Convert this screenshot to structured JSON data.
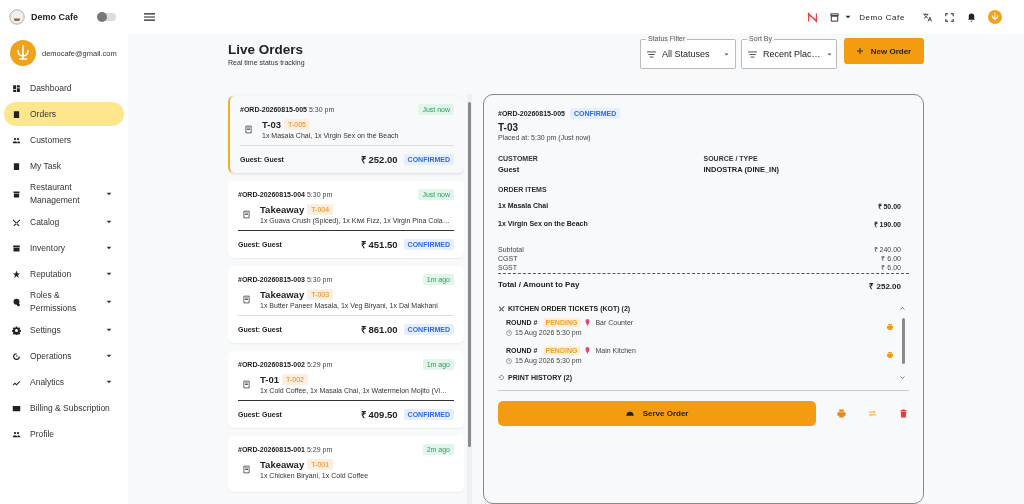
{
  "brand": {
    "name": "Demo Cafe",
    "theme_toggle_on": false
  },
  "user": {
    "email": "democafe@gmail.com"
  },
  "sidebar": {
    "items": [
      {
        "label": "Dashboard",
        "selected": false,
        "expandable": false
      },
      {
        "label": "Orders",
        "selected": true,
        "expandable": false
      },
      {
        "label": "Customers",
        "selected": false,
        "expandable": false
      },
      {
        "label": "My Task",
        "selected": false,
        "expandable": false
      },
      {
        "label": "Restaurant Management",
        "selected": false,
        "expandable": true
      },
      {
        "label": "Catalog",
        "selected": false,
        "expandable": true
      },
      {
        "label": "Inventory",
        "selected": false,
        "expandable": true
      },
      {
        "label": "Reputation",
        "selected": false,
        "expandable": true
      },
      {
        "label": "Roles & Permissions",
        "selected": false,
        "expandable": true
      },
      {
        "label": "Settings",
        "selected": false,
        "expandable": true
      },
      {
        "label": "Operations",
        "selected": false,
        "expandable": true
      },
      {
        "label": "Analytics",
        "selected": false,
        "expandable": true
      },
      {
        "label": "Billing & Subscription",
        "selected": false,
        "expandable": false
      },
      {
        "label": "Profile",
        "selected": false,
        "expandable": false
      }
    ]
  },
  "topbar": {
    "outlet": "Demo Cafe"
  },
  "page": {
    "title": "Live Orders",
    "subtitle": "Real time status tracking"
  },
  "filters": [
    {
      "legend": "Status Filter",
      "value": "All Statuses"
    },
    {
      "legend": "Sort By",
      "value": "Recent Plac…"
    }
  ],
  "new_order_button": "New Order",
  "orders": [
    {
      "id": "#ORD-20260815-005",
      "time": "5:30 pm",
      "age": "Just now",
      "title": "T-03",
      "tag": "T-005",
      "items": "1x Masala Chai, 1x Virgin Sex on the Beach",
      "guest": "Guest: Guest",
      "amount": "₹ 252.00",
      "status": "CONFIRMED",
      "selected": true
    },
    {
      "id": "#ORD-20260815-004",
      "time": "5:30 pm",
      "age": "Just now",
      "title": "Takeaway",
      "tag": "T-004",
      "items": "1x Guava Crush (Spiced), 1x Kiwi Fizz, 1x Virgin Pina Cola…",
      "guest": "Guest: Guest",
      "amount": "₹ 451.50",
      "status": "CONFIRMED",
      "selected": false
    },
    {
      "id": "#ORD-20260815-003",
      "time": "5:30 pm",
      "age": "1m ago",
      "title": "Takeaway",
      "tag": "T-003",
      "items": "1x Butter Paneer Masala, 1x Veg Biryani, 1x Dal Makhani",
      "guest": "Guest: Guest",
      "amount": "₹ 861.00",
      "status": "CONFIRMED",
      "selected": false
    },
    {
      "id": "#ORD-20260815-002",
      "time": "5:29 pm",
      "age": "1m ago",
      "title": "T-01",
      "tag": "T-002",
      "items": "1x Cold Coffee, 1x Masala Chai, 1x Watermelon Mojito (Vi…",
      "guest": "Guest: Guest",
      "amount": "₹ 409.50",
      "status": "CONFIRMED",
      "selected": false
    },
    {
      "id": "#ORD-20260815-001",
      "time": "5:29 pm",
      "age": "2m ago",
      "title": "Takeaway",
      "tag": "T-001",
      "items": "1x Chicken Biryani, 1x Cold Coffee",
      "selected": false
    }
  ],
  "detail": {
    "id": "#ORD-20260815-005",
    "status": "CONFIRMED",
    "title": "T-03",
    "placed": "Placed at: 5:30 pm (Just now)",
    "info": [
      {
        "label": "CUSTOMER",
        "value": "Guest"
      },
      {
        "label": "SOURCE / TYPE",
        "value": "INDOSTRA (DINE_IN)"
      }
    ],
    "items_label": "ORDER ITEMS",
    "items": [
      {
        "name": "1x Masala Chai",
        "price": "₹ 50.00"
      },
      {
        "name": "1x Virgin Sex on the Beach",
        "price": "₹ 190.00"
      }
    ],
    "charges": [
      {
        "label": "Subtotal",
        "value": "₹ 240.00"
      },
      {
        "label": "CGST",
        "value": "₹ 6.00"
      },
      {
        "label": "SGST",
        "value": "₹ 6.00"
      }
    ],
    "total": {
      "label": "Total / Amount to Pay",
      "value": "₹ 252.00"
    },
    "kot": {
      "title": "KITCHEN ORDER TICKETS (KOT) (2)",
      "expanded": true,
      "rounds": [
        {
          "label": "ROUND #",
          "status": "PENDING",
          "station": "Bar Counter",
          "time": "15 Aug 2026 5:30 pm"
        },
        {
          "label": "ROUND #",
          "status": "PENDING",
          "station": "Main Kitchen",
          "time": "15 Aug 2026 5:30 pm"
        }
      ]
    },
    "print_history": {
      "title": "PRINT HISTORY (2)",
      "expanded": false
    },
    "serve_button": "Serve Order"
  }
}
